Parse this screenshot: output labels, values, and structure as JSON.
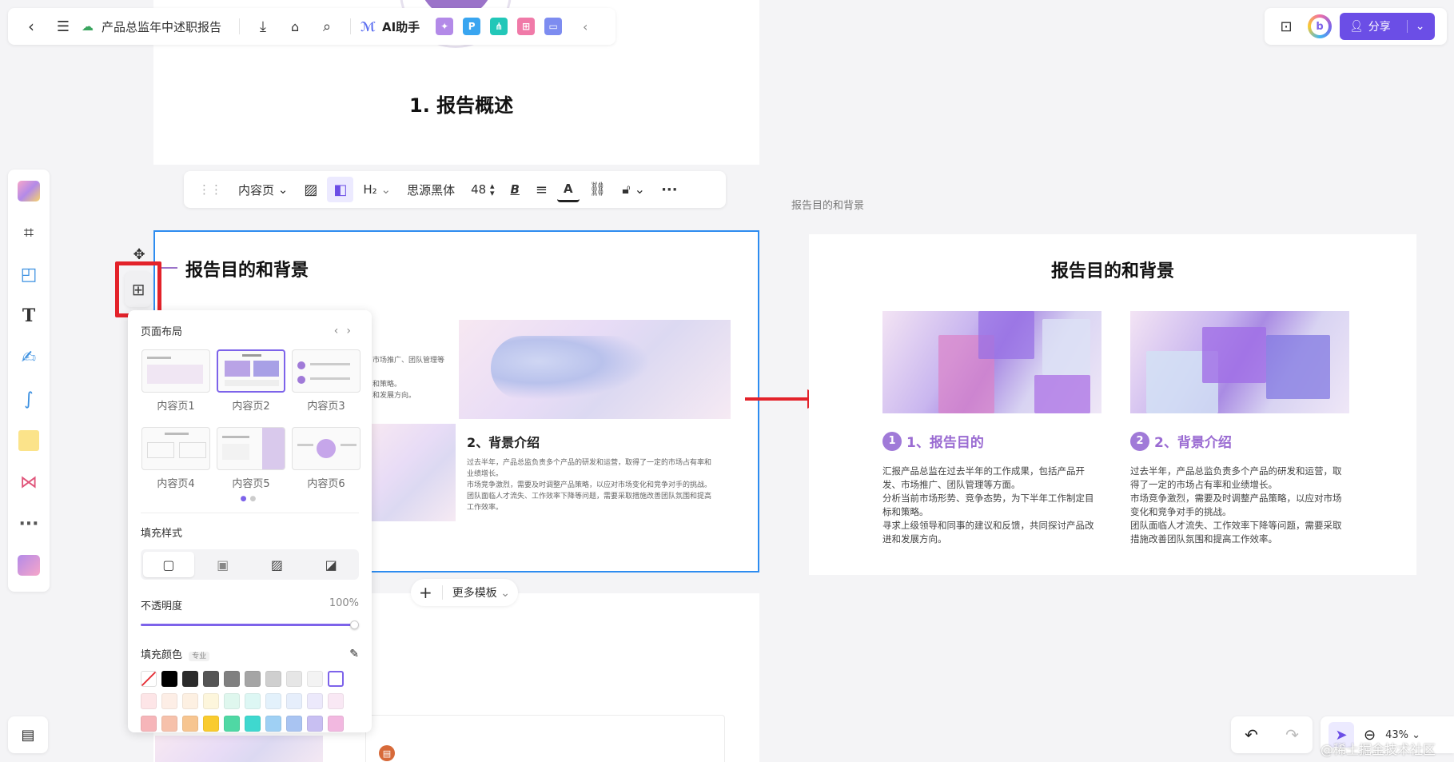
{
  "topbar": {
    "doc_title": "产品总监年中述职报告",
    "ai_label": "AI助手",
    "app_tiles": [
      {
        "icon": "image-gen-icon",
        "color": "#b38ae8",
        "glyph": "✦"
      },
      {
        "icon": "p-app-icon",
        "color": "#39a5f0",
        "glyph": "P"
      },
      {
        "icon": "mindmap-app-icon",
        "color": "#22c7b8",
        "glyph": "⋔"
      },
      {
        "icon": "flow-app-icon",
        "color": "#f07aa8",
        "glyph": "⊞"
      },
      {
        "icon": "chat-app-icon",
        "color": "#7d8cf0",
        "glyph": "▭"
      }
    ]
  },
  "topright": {
    "share_label": "分享"
  },
  "slide_top": {
    "heading": "1. 报告概述"
  },
  "formatbar": {
    "page_type": "内容页",
    "heading_level": "H₂",
    "font_name": "思源黑体",
    "font_size": "48"
  },
  "slide_main": {
    "title": "报告目的和背景",
    "left_snippet": [
      "市场推广、团队管理等",
      "和策略。",
      "和发展方向。"
    ],
    "section2_title": "2、背景介绍",
    "section2_body": [
      "过去半年，产品总监负责多个产品的研发和运营，取得了一定的市场占有率和",
      "业绩增长。",
      "市场竞争激烈，需要及时调整产品策略，以应对市场变化和竞争对手的挑战。",
      "团队面临人才流失、工作效率下降等问题，需要采取措施改善团队氛围和提高",
      "工作效率。"
    ]
  },
  "layout_panel": {
    "title": "页面布局",
    "layouts": [
      {
        "label": "内容页1",
        "selected": false
      },
      {
        "label": "内容页2",
        "selected": true
      },
      {
        "label": "内容页3",
        "selected": false
      },
      {
        "label": "内容页4",
        "selected": false
      },
      {
        "label": "内容页5",
        "selected": false
      },
      {
        "label": "内容页6",
        "selected": false
      }
    ],
    "fill_style_label": "填充样式",
    "opacity_label": "不透明度",
    "opacity_value": "100%",
    "opacity_fraction": 1.0,
    "fill_color_label": "填充颜色",
    "fill_color_badge": "专业",
    "swatch_colors": [
      "#ffffff",
      "#000000",
      "#2b2b2b",
      "#555555",
      "#808080",
      "#a5a5a5",
      "#cfcfcf",
      "#e6e6e6",
      "#f3f3f3",
      "#ffffff",
      "#fde5e7",
      "#fdeee6",
      "#fdf0e2",
      "#fdf6dc",
      "#dff7ee",
      "#ddf7f4",
      "#e3f1fb",
      "#e6eefb",
      "#ece9fb",
      "#f9e8f4",
      "#f6b5b9",
      "#f6c1ab",
      "#f7c590",
      "#f9cb2e",
      "#4fd8a4",
      "#3fd8cf",
      "#9fd0f4",
      "#a9c4f2",
      "#c8bff2",
      "#f2b8e0"
    ]
  },
  "bottom": {
    "more_templates": "更多模板",
    "zoom": "43%"
  },
  "preview": {
    "label": "报告目的和背景",
    "title": "报告目的和背景",
    "sections": [
      {
        "num": "1",
        "title": "1、报告目的",
        "body": [
          "汇报产品总监在过去半年的工作成果，包括产品开",
          "发、市场推广、团队管理等方面。",
          "分析当前市场形势、竞争态势，为下半年工作制定目",
          "标和策略。",
          "寻求上级领导和同事的建议和反馈，共同探讨产品改",
          "进和发展方向。"
        ]
      },
      {
        "num": "2",
        "title": "2、背景介绍",
        "body": [
          "过去半年，产品总监负责多个产品的研发和运营，取",
          "得了一定的市场占有率和业绩增长。",
          "市场竞争激烈，需要及时调整产品策略，以应对市场",
          "变化和竞争对手的挑战。",
          "团队面临人才流失、工作效率下降等问题，需要采取",
          "措施改善团队氛围和提高工作效率。"
        ]
      }
    ]
  },
  "watermark": "@稀土掘金技术社区"
}
